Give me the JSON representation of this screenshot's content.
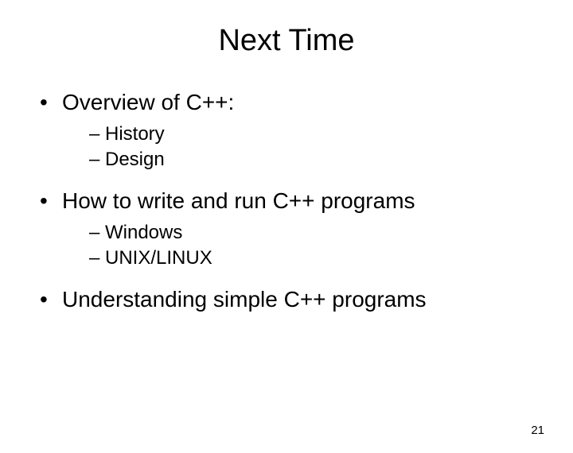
{
  "title": "Next Time",
  "bullets": [
    {
      "text": "Overview of C++:",
      "sub": [
        "History",
        "Design"
      ]
    },
    {
      "text": "How to write and run C++ programs",
      "sub": [
        "Windows",
        "UNIX/LINUX"
      ]
    },
    {
      "text": "Understanding simple C++ programs",
      "sub": []
    }
  ],
  "page_number": "21"
}
